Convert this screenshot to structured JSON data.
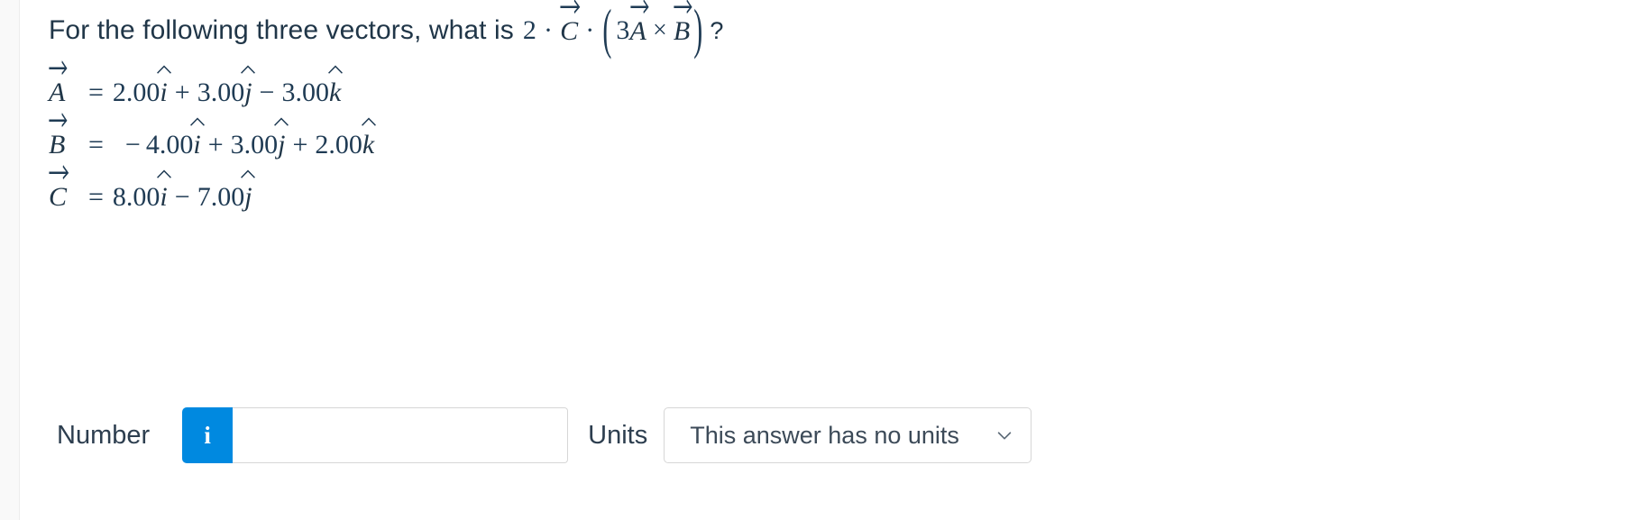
{
  "question": {
    "lead_text": "For the following three vectors, what is",
    "expression": {
      "coefficient": "2",
      "dot1": "·",
      "vector_c": "C",
      "dot2": "·",
      "open_paren": "(",
      "inner_coefficient": "3",
      "vector_a": "A",
      "cross": "×",
      "vector_b": "B",
      "close_paren": ")",
      "question_mark": "?"
    }
  },
  "definitions": [
    {
      "name": "A",
      "equals": "=",
      "terms": [
        {
          "sign": "",
          "value": "2.00",
          "unit": "i"
        },
        {
          "sign": "+",
          "value": "3.00",
          "unit": "j"
        },
        {
          "sign": "−",
          "value": "3.00",
          "unit": "k"
        }
      ]
    },
    {
      "name": "B",
      "equals": "=",
      "terms": [
        {
          "sign": "−",
          "value": "4.00",
          "unit": "i"
        },
        {
          "sign": "+",
          "value": "3.00",
          "unit": "j"
        },
        {
          "sign": "+",
          "value": "2.00",
          "unit": "k"
        }
      ]
    },
    {
      "name": "C",
      "equals": "=",
      "terms": [
        {
          "sign": "",
          "value": "8.00",
          "unit": "i"
        },
        {
          "sign": "−",
          "value": "7.00",
          "unit": "j"
        }
      ]
    }
  ],
  "answer": {
    "number_label": "Number",
    "info_icon": "info-icon",
    "info_glyph": "i",
    "number_value": "",
    "number_placeholder": "",
    "units_label": "Units",
    "units_selected": "This answer has no units",
    "chevron_icon": "chevron-down-icon"
  },
  "colors": {
    "accent_blue": "#0089e0",
    "text": "#203648",
    "math_text": "#1f3b54",
    "border": "#d6d6d6",
    "gutter": "#f9f9f9"
  }
}
